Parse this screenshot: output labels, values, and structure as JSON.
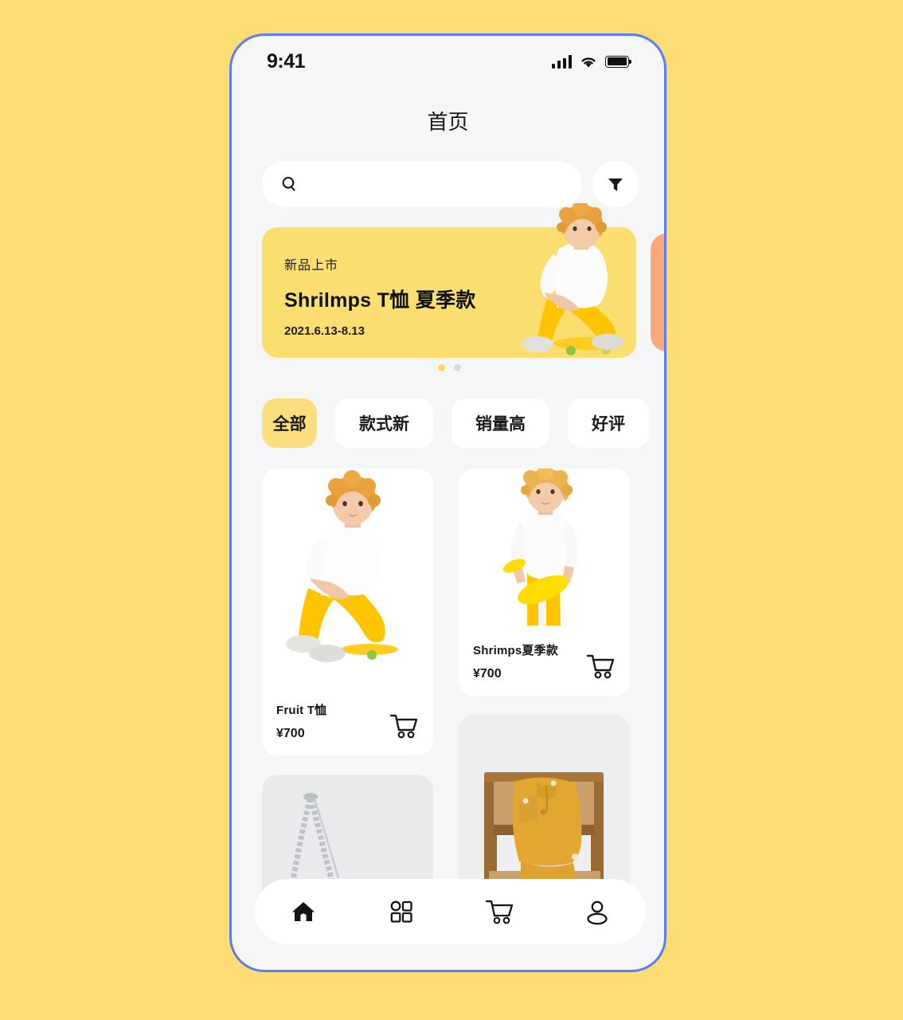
{
  "theme": {
    "page_bg": "#FFDD75",
    "phone_border": "#5B7CF5",
    "screen_bg": "#F5F6F8",
    "accent_yellow": "#FBDE70",
    "chip_active_yellow": "#FDDE7E",
    "banner_next_orange": "#F9A97A",
    "dot_active": "#FCD95C",
    "dot_inactive": "#D6D8DC",
    "text_primary": "#161616"
  },
  "status_bar": {
    "time": "9:41",
    "signal_icon": "signal-bars-icon",
    "wifi_icon": "wifi-icon",
    "battery_icon": "battery-full-icon"
  },
  "header": {
    "title": "首页"
  },
  "search": {
    "value": "",
    "placeholder": "",
    "search_icon": "search-icon",
    "filter_icon": "filter-funnel-icon"
  },
  "banner": {
    "kicker": "新品上市",
    "title": "Shrilmps  T恤 夏季款",
    "date": "2021.6.13-8.13",
    "dots": [
      {
        "active": true
      },
      {
        "active": false
      }
    ]
  },
  "chips": [
    {
      "label": "全部",
      "active": true
    },
    {
      "label": "款式新",
      "active": false
    },
    {
      "label": "销量高",
      "active": false
    },
    {
      "label": "好评",
      "active": false
    }
  ],
  "products": [
    {
      "name": "Fruit  T恤",
      "price": "¥700",
      "image": "model-sitting-on-skateboard",
      "cart_icon": "shopping-cart-icon"
    },
    {
      "name": "Shrimps夏季款",
      "price": "¥700",
      "image": "model-holding-yellow-skateboard",
      "cart_icon": "shopping-cart-icon"
    },
    {
      "name": "",
      "price": "",
      "image": "handbag-with-chain-strap",
      "cart_icon": ""
    },
    {
      "name": "",
      "price": "",
      "image": "mustard-garment-on-wooden-chair",
      "cart_icon": ""
    }
  ],
  "tabbar": [
    {
      "icon": "home-icon",
      "active": true
    },
    {
      "icon": "grid-categories-icon",
      "active": false
    },
    {
      "icon": "shopping-cart-icon",
      "active": false
    },
    {
      "icon": "user-profile-icon",
      "active": false
    }
  ]
}
